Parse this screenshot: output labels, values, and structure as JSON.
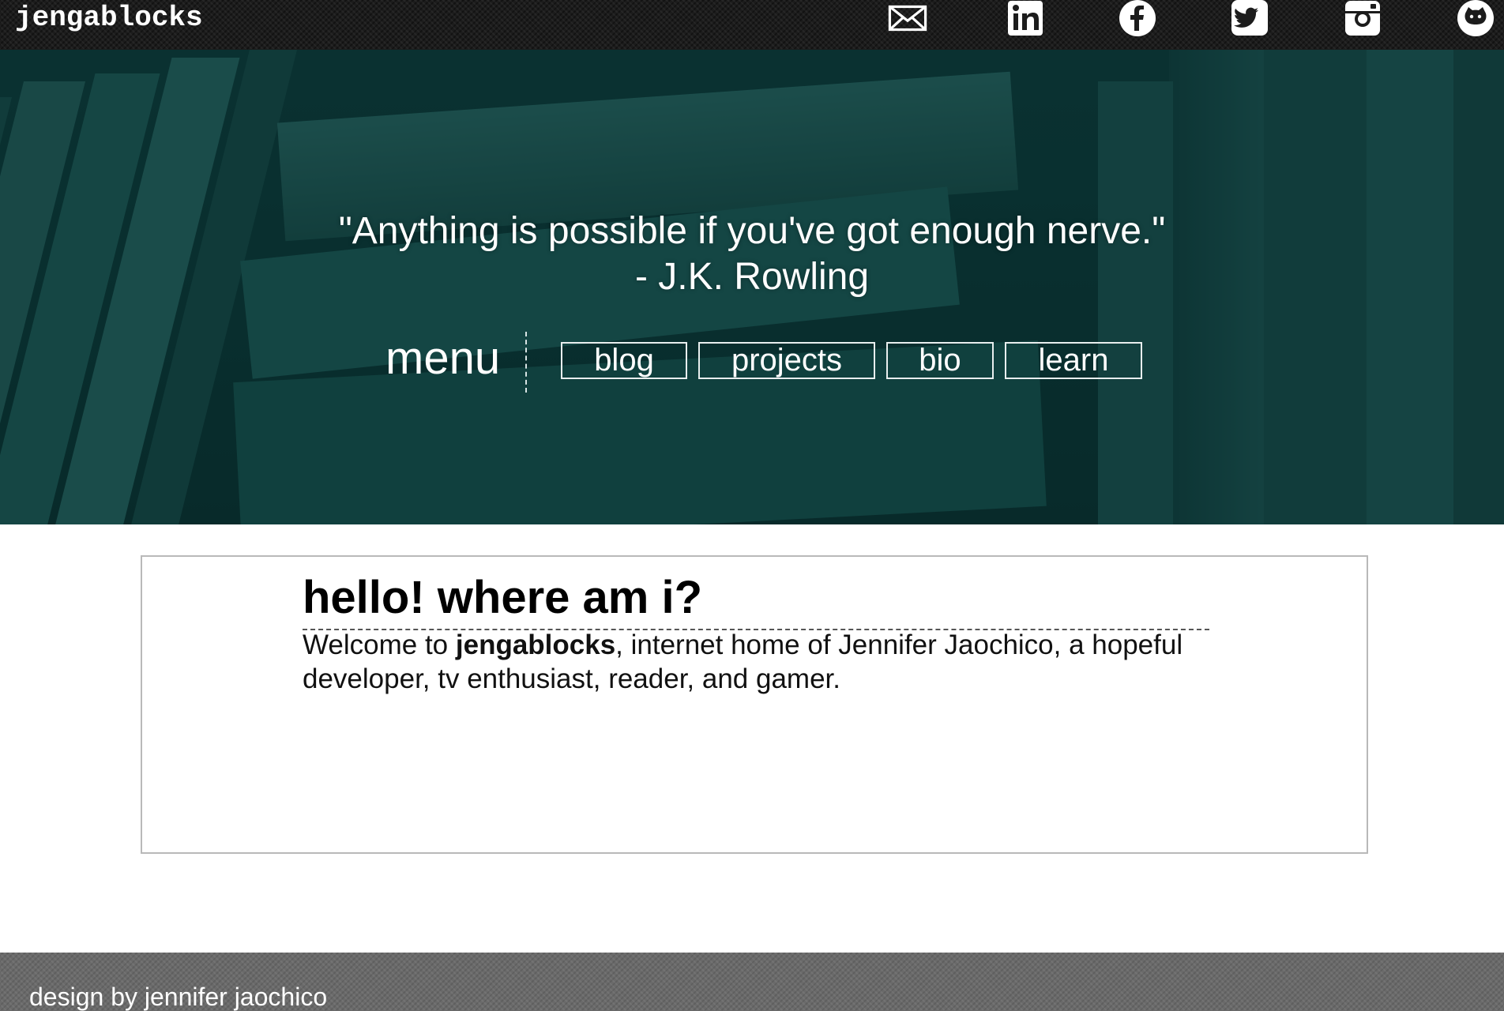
{
  "header": {
    "site_title": "jengablocks",
    "social_icons": [
      "email-icon",
      "linkedin-icon",
      "facebook-icon",
      "twitter-icon",
      "instagram-icon",
      "github-icon"
    ]
  },
  "hero": {
    "quote_text": "\"Anything is possible if you've got enough nerve.\"",
    "quote_author": "- J.K. Rowling",
    "menu_label": "menu",
    "nav": [
      {
        "label": "blog"
      },
      {
        "label": "projects"
      },
      {
        "label": "bio"
      },
      {
        "label": "learn"
      }
    ]
  },
  "content": {
    "heading": "hello! where am i?",
    "body_prefix": "Welcome to ",
    "body_bold": "jengablocks",
    "body_suffix": ", internet home of Jennifer Jaochico, a hopeful developer, tv enthusiast, reader, and gamer."
  },
  "footer": {
    "credit": "design by jennifer jaochico"
  },
  "colors": {
    "topbar": "#1c1c1c",
    "hero_tint": "#0f3a3a",
    "footer": "#6a6a6a"
  }
}
